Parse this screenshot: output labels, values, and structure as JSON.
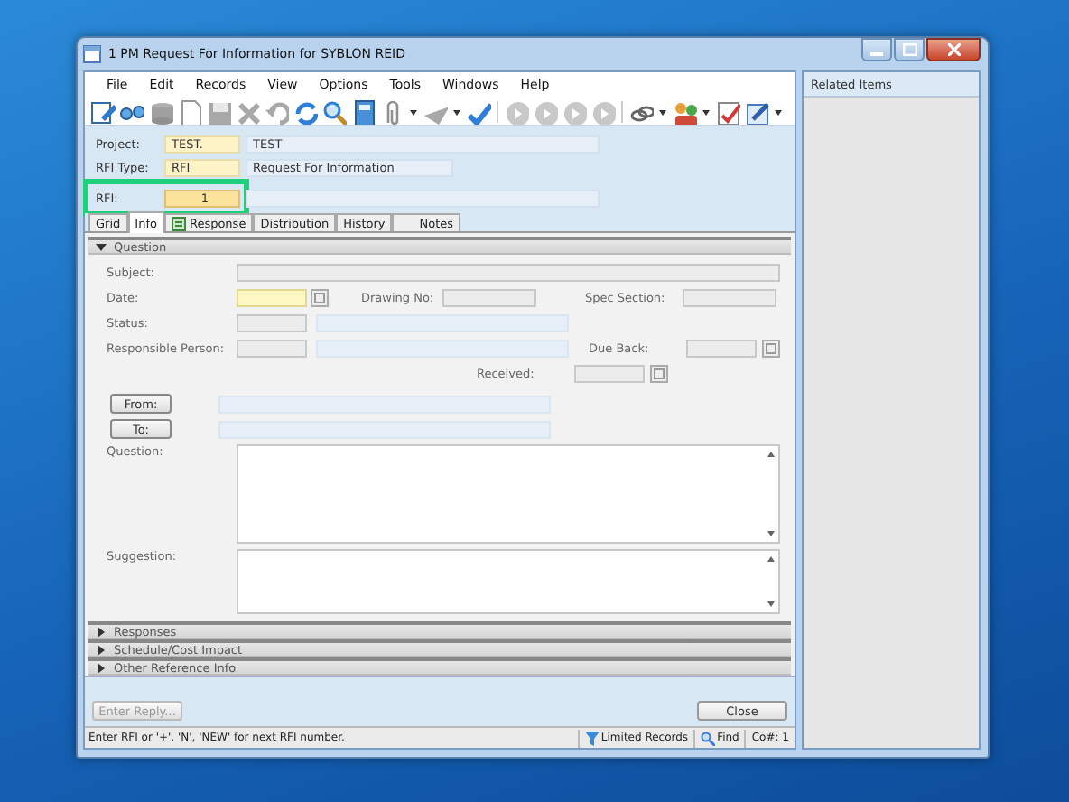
{
  "window": {
    "title": "1 PM Request For Information for SYBLON REID"
  },
  "menu": [
    "File",
    "Edit",
    "Records",
    "View",
    "Options",
    "Tools",
    "Windows",
    "Help"
  ],
  "header": [
    {
      "label": "Project:",
      "code": "TEST.",
      "description": "TEST",
      "highlighted": false
    },
    {
      "label": "RFI Type:",
      "code": "RFI",
      "description": "Request For Information",
      "highlighted": false
    },
    {
      "label": "RFI:",
      "code": "1",
      "highlighted": true
    }
  ],
  "tabs": [
    {
      "label": "Grid",
      "selected": false
    },
    {
      "label": "Info",
      "selected": true
    },
    {
      "label": "Response",
      "selected": false
    },
    {
      "label": "Distribution",
      "selected": false
    },
    {
      "label": "History",
      "selected": false
    },
    {
      "label": "Notes",
      "selected": false
    }
  ],
  "question": {
    "title": "Question",
    "expanded": true,
    "subject": "Subject:",
    "date": "Date:",
    "drawing_no": "Drawing No:",
    "spec_section": "Spec Section:",
    "status": "Status:",
    "responsible_person": "Responsible Person:",
    "due_back": "Due Back:",
    "received": "Received:",
    "from_button": "From:",
    "to_button": "To:",
    "question_label": "Question:",
    "suggestion_label": "Suggestion:"
  },
  "sections": [
    {
      "title": "Responses",
      "expanded": false
    },
    {
      "title": "Schedule/Cost Impact",
      "expanded": false
    },
    {
      "title": "Other Reference Info",
      "expanded": false
    }
  ],
  "buttons": [
    {
      "label": "Enter Reply...",
      "disabled": true
    },
    {
      "label": "Close",
      "disabled": false
    }
  ],
  "status_bar": {
    "message": "Enter RFI or '+', 'N', 'NEW' for next RFI number.",
    "limited": "Limited Records",
    "find": "Find",
    "company": "Co#: 1"
  },
  "related_panel": {
    "title": "Related Items"
  }
}
